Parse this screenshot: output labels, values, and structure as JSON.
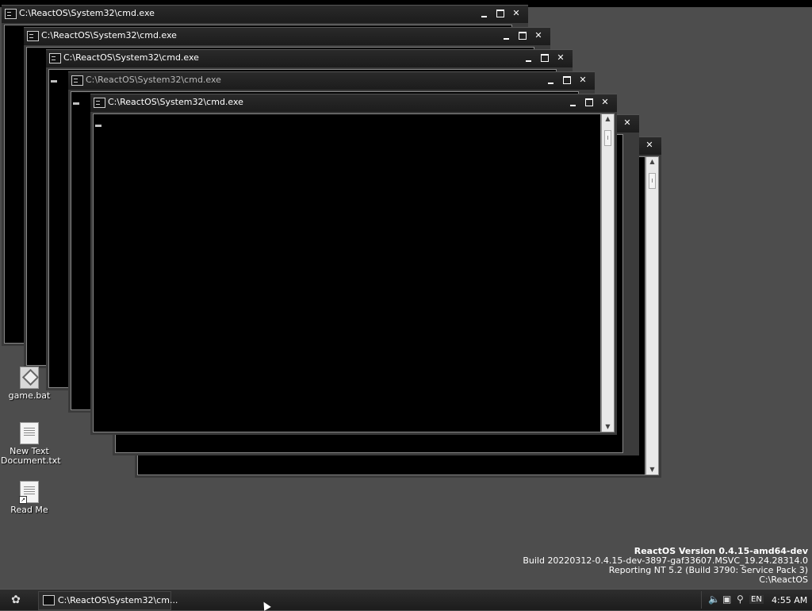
{
  "window_title": "C:\\ReactOS\\System32\\cmd.exe",
  "window_controls": {
    "minimize": "minimize",
    "maximize": "maximize",
    "close": "close"
  },
  "desktop_icons": [
    {
      "label": "game.bat",
      "icon": "batch-file-icon"
    },
    {
      "label": "New Text Document.txt",
      "icon": "text-document-icon"
    },
    {
      "label": "Read Me",
      "icon": "shortcut-document-icon"
    }
  ],
  "version_info": {
    "title": "ReactOS Version 0.4.15-amd64-dev",
    "build": "Build 20220312-0.4.15-dev-3897-gaf33607.MSVC_19.24.28314.0",
    "reporting": "Reporting NT 5.2 (Build 3790: Service Pack 3)",
    "path": "C:\\ReactOS"
  },
  "taskbar": {
    "task_label": "C:\\ReactOS\\System32\\cm...",
    "tray": {
      "language": "EN",
      "clock": "4:55 AM"
    }
  },
  "colors": {
    "desktop": "#4d4d4d",
    "titlebar": "#1c1c1c",
    "console_bg": "#000000"
  }
}
